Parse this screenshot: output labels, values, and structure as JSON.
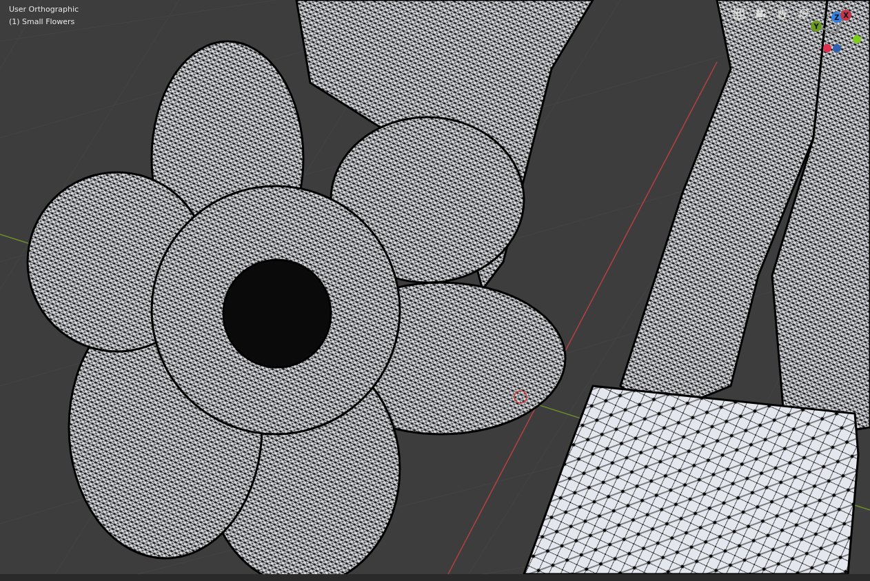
{
  "viewport": {
    "view_name": "User Orthographic",
    "object_label": "(1) Small Flowers"
  },
  "gizmo": {
    "axes": [
      {
        "label": "Z",
        "color": "#2f83e6"
      },
      {
        "label": "X",
        "color": "#c1364a"
      },
      {
        "label": "Y",
        "color": "#6a9a1f"
      }
    ]
  }
}
